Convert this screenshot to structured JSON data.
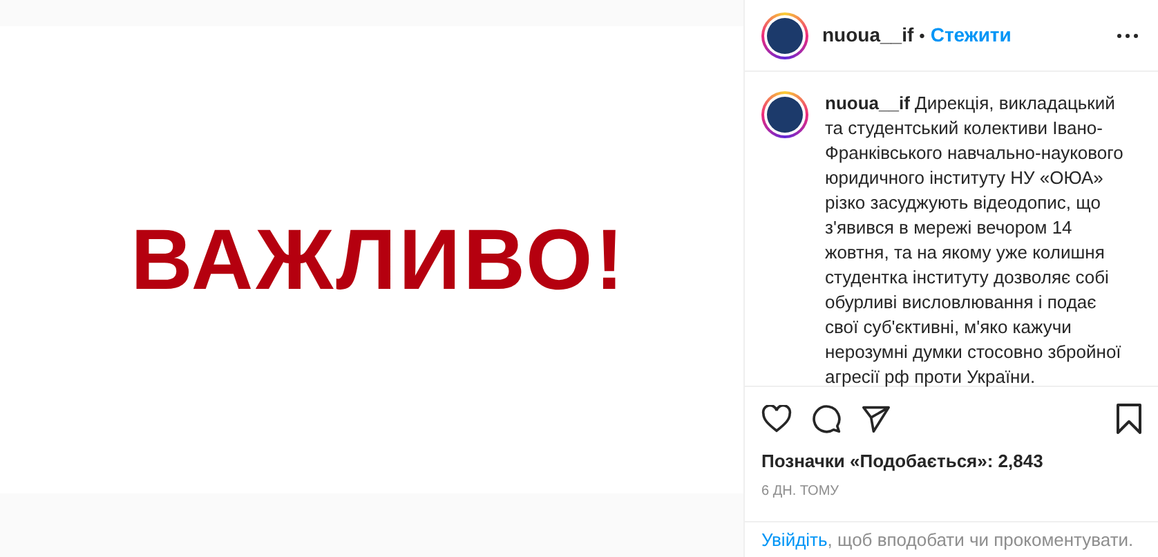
{
  "post_image": {
    "text": "ВАЖЛИВО!"
  },
  "header": {
    "username": "nuoua__if",
    "separator": "•",
    "follow": "Стежити"
  },
  "caption": {
    "username": "nuoua__if",
    "text": "Дирекція, викладацький та студентський колективи Івано-Франківського навчально-наукового юридичного інституту НУ «ОЮА» різко засуджують відеодопис, що з'явився в мережі вечором 14 жовтня, та на якому уже колишня студентка інституту дозволяє собі обурливі висловлювання і подає свої суб'єктивні, м'яко кажучи нерозумні думки стосовно збройної агресії рф проти України."
  },
  "likes": "Позначки «Подобається»: 2,843",
  "time": "6 ДН. ТОМУ",
  "login": {
    "link": "Увійдіть",
    "text": ", щоб вподобати чи прокоментувати."
  }
}
